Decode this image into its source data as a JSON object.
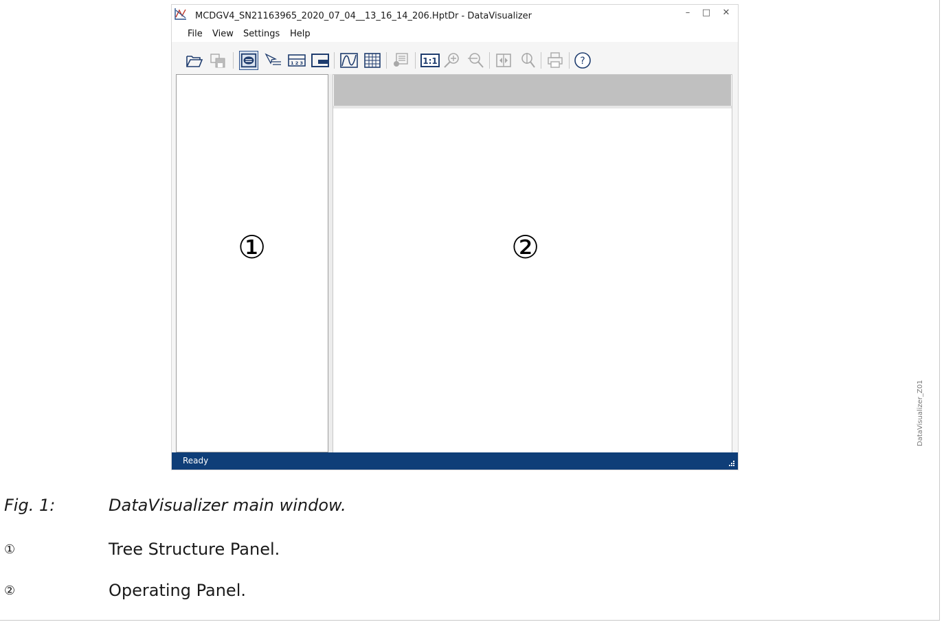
{
  "window": {
    "title": "MCDGV4_SN21163965_2020_07_04__13_16_14_206.HptDr - DataVisualizer",
    "buttons": {
      "minimize": "–",
      "maximize": "□",
      "close": "✕"
    }
  },
  "menu": {
    "file": "File",
    "view": "View",
    "settings": "Settings",
    "help": "Help"
  },
  "toolbar": {
    "icons": [
      "open-folder-icon",
      "save-icon",
      "toggle-tree-panel-icon",
      "cursor-icon",
      "measurement-table-icon",
      "split-view-icon",
      "analog-curve-icon",
      "grid-table-icon",
      "legend-icon",
      "zoom-1-1-icon",
      "zoom-in-icon",
      "zoom-out-icon",
      "fit-width-icon",
      "find-zoom-icon",
      "print-icon",
      "help-icon"
    ],
    "zoom_reset_label": "1:1",
    "help_label": "?"
  },
  "panels": {
    "tree_callout": "①",
    "operating_callout": "②"
  },
  "status": {
    "text": "Ready"
  },
  "side_label": "DataVisualizer_Z01",
  "caption": {
    "fig_label": "Fig. 1:",
    "fig_text": "DataVisualizer main window.",
    "items": [
      {
        "marker": "①",
        "text": "Tree Structure Panel."
      },
      {
        "marker": "②",
        "text": "Operating Panel."
      }
    ]
  },
  "colors": {
    "statusbar": "#0f3e78",
    "toolbar_icon": "#1e3c6e",
    "disabled_icon": "#a8a8a8"
  }
}
